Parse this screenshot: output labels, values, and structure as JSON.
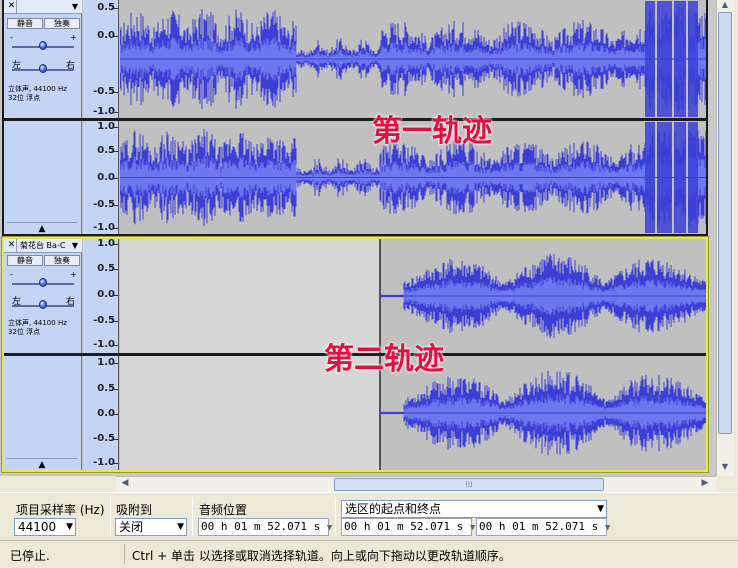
{
  "tracks": [
    {
      "name": "",
      "mute_label": "静音",
      "solo_label": "独奏",
      "gain_minus": "-",
      "gain_plus": "+",
      "pan_left": "左",
      "pan_right": "右",
      "info_line1": "立体声, 44100 Hz",
      "info_line2": "32位 浮点",
      "overlay_label": "第一轨迹",
      "ticks": [
        "0.5",
        "0.0",
        "-0.5",
        "-1.0",
        "1.0",
        "0.5",
        "0.0",
        "-0.5",
        "-1.0"
      ],
      "waveform_start_fraction": 0.0,
      "selected": false
    },
    {
      "name": "菊花台 Ba-C",
      "mute_label": "静音",
      "solo_label": "独奏",
      "gain_minus": "-",
      "gain_plus": "+",
      "pan_left": "左",
      "pan_right": "右",
      "info_line1": "立体声, 44100 Hz",
      "info_line2": "32位 浮点",
      "overlay_label": "第二轨迹",
      "ticks": [
        "1.0",
        "0.5",
        "0.0",
        "-0.5",
        "-1.0",
        "1.0",
        "0.5",
        "0.0",
        "-0.5",
        "-1.0"
      ],
      "waveform_start_fraction": 0.44,
      "selected": true
    }
  ],
  "selection_toolbar": {
    "rate_label": "项目采样率 (Hz)",
    "rate_value": "44100",
    "snap_label": "吸附到",
    "snap_value": "关闭",
    "audio_pos_label": "音频位置",
    "audio_pos_value": "00 h 01 m 52.071 s",
    "selection_mode_value": "选区的起点和终点",
    "sel_start_value": "00 h 01 m 52.071 s",
    "sel_end_value": "00 h 01 m 52.071 s"
  },
  "status": {
    "state": "已停止.",
    "hint": "Ctrl + 单击 以选择或取消选择轨道。向上或向下拖动以更改轨道顺序。"
  },
  "colors": {
    "waveform": "#3b3fd6",
    "waveform_rms": "#6d78ee",
    "track_panel": "#c3d4f4",
    "selected_border": "#e6e650",
    "overlay_text": "#e01040"
  },
  "icons": {
    "close": "close-icon",
    "dropdown": "chevron-down-icon",
    "collapse": "collapse-up-icon",
    "scroll_left": "arrow-left-icon",
    "scroll_right": "arrow-right-icon",
    "scroll_up": "arrow-up-icon",
    "scroll_down": "arrow-down-icon"
  }
}
